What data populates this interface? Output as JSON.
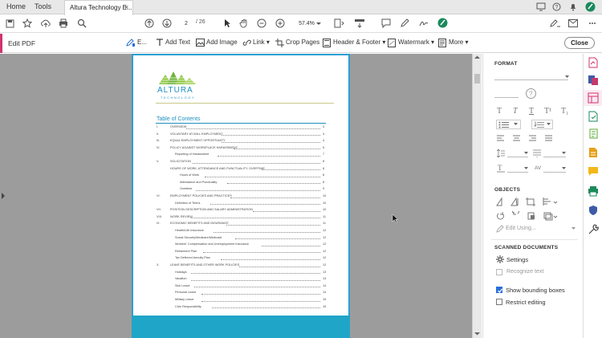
{
  "tabbar": {
    "home": "Home",
    "tools": "Tools",
    "doc_tab_title": "Altura Technology E...",
    "close_glyph": "×"
  },
  "toolbar": {
    "current_page": "2",
    "total_pages": "/ 26",
    "zoom": "57.4%"
  },
  "editbar": {
    "title": "Edit PDF",
    "tools": [
      {
        "name": "edit-text-tool",
        "label": "E..."
      },
      {
        "name": "add-text-tool",
        "label": "Add Text"
      },
      {
        "name": "add-image-tool",
        "label": "Add Image"
      },
      {
        "name": "link-tool",
        "label": "Link ▾"
      },
      {
        "name": "crop-pages-tool",
        "label": "Crop Pages"
      },
      {
        "name": "header-footer-tool",
        "label": "Header & Footer ▾"
      },
      {
        "name": "watermark-tool",
        "label": "Watermark ▾"
      },
      {
        "name": "more-tool",
        "label": "More ▾"
      }
    ],
    "close_label": "Close"
  },
  "document": {
    "logo_line1": "ALTURA",
    "logo_line2": "TECHNOLOGY",
    "toc_title": "Table of Contents",
    "toc": [
      {
        "num": "I.",
        "text": "OVERVIEW",
        "page": "4",
        "indent": 0
      },
      {
        "num": "II.",
        "text": "VOLUNTARY AT-WILL EMPLOYMENT",
        "page": "4",
        "indent": 0
      },
      {
        "num": "III.",
        "text": "EQUAL EMPLOYMENT OPPORTUNITY",
        "page": "4",
        "indent": 0
      },
      {
        "num": "IV.",
        "text": "POLICY AGAINST WORKPLACE HARASSMENT",
        "page": "5",
        "indent": 0
      },
      {
        "num": "",
        "text": "Reporting of Harassment",
        "page": "7",
        "indent": 1
      },
      {
        "num": "V.",
        "text": "SOLICITATION",
        "page": "8",
        "indent": 0
      },
      {
        "num": "",
        "text": "HOURS OF WORK, ATTENDANCE AND PUNCTUALITY, OVERTIME",
        "page": "8",
        "indent": 0
      },
      {
        "num": "",
        "text": "Hours of Work",
        "page": "8",
        "indent": 2
      },
      {
        "num": "",
        "text": "Attendance and Punctuality",
        "page": "8",
        "indent": 2
      },
      {
        "num": "",
        "text": "Overtime",
        "page": "9",
        "indent": 2
      },
      {
        "num": "VI.",
        "text": "EMPLOYMENT POLICIES AND PRACTICES",
        "page": "10",
        "indent": 0
      },
      {
        "num": "",
        "text": "Definition of Terms",
        "page": "10",
        "indent": 1
      },
      {
        "num": "VII.",
        "text": "POSITION DESCRIPTION AND SALARY ADMINISTRATION",
        "page": "10",
        "indent": 0
      },
      {
        "num": "VIII.",
        "text": "WORK REVIEW",
        "page": "11",
        "indent": 0
      },
      {
        "num": "IX.",
        "text": "ECONOMIC BENEFITS AND INSURANCE",
        "page": "11",
        "indent": 0
      },
      {
        "num": "",
        "text": "Health/Life Insurance",
        "page": "12",
        "indent": 1
      },
      {
        "num": "",
        "text": "Social Security/Medicare/Medicaid",
        "page": "12",
        "indent": 1
      },
      {
        "num": "",
        "text": "Workers' Compensation and Unemployment Insurance",
        "page": "12",
        "indent": 1
      },
      {
        "num": "",
        "text": "Retirement Plan",
        "page": "12",
        "indent": 1
      },
      {
        "num": "",
        "text": "Tax Deferred Annuity Plan",
        "page": "12",
        "indent": 1
      },
      {
        "num": "X.",
        "text": "LEAVE BENEFITS AND OTHER WORK POLICIES",
        "page": "12",
        "indent": 0
      },
      {
        "num": "",
        "text": "Holidays",
        "page": "13",
        "indent": 1
      },
      {
        "num": "",
        "text": "Vacation",
        "page": "13",
        "indent": 1
      },
      {
        "num": "",
        "text": "Sick Leave",
        "page": "14",
        "indent": 1
      },
      {
        "num": "",
        "text": "Personal Leave",
        "page": "14",
        "indent": 1
      },
      {
        "num": "",
        "text": "Military Leave",
        "page": "15",
        "indent": 1
      },
      {
        "num": "",
        "text": "Civic Responsibility",
        "page": "15",
        "indent": 1
      }
    ]
  },
  "panel": {
    "format_heading": "FORMAT",
    "objects_heading": "OBJECTS",
    "edit_using": "Edit Using...",
    "scanned_heading": "SCANNED DOCUMENTS",
    "settings_label": "Settings",
    "recognize_label": "Recognize text",
    "show_bbox_label": "Show bounding boxes",
    "show_bbox_checked": true,
    "restrict_label": "Restrict editing",
    "restrict_checked": false,
    "char_spacing_label": "AV"
  },
  "colors": {
    "accent": "#d1336e",
    "page_border": "#2aa0d2",
    "footer": "#1fa5c8",
    "logo_green": "#8cc63f",
    "logo_text": "#1e8fc0"
  }
}
